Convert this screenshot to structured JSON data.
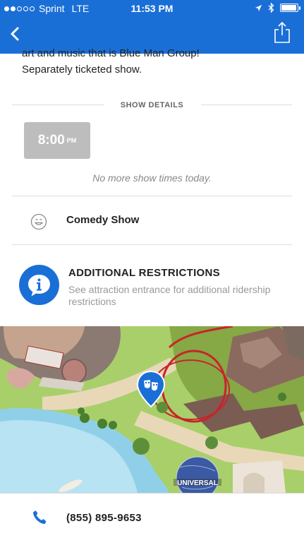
{
  "status_bar": {
    "carrier": "Sprint",
    "network": "LTE",
    "time": "11:53 PM",
    "signal_bars_filled": 2,
    "signal_bars_total": 5
  },
  "header": {
    "color": "#1a6fd6",
    "back_icon": "chevron-left-icon",
    "share_icon": "share-icon"
  },
  "description": {
    "line1": "art and music that is Blue Man Group!",
    "line2": "Separately ticketed show."
  },
  "show_details": {
    "label": "SHOW DETAILS",
    "show_time": "8:00",
    "show_time_ampm": "PM",
    "no_more_text": "No more show times today."
  },
  "show_type": {
    "icon": "smiley-icon",
    "label": "Comedy Show"
  },
  "restrictions": {
    "icon": "info-icon",
    "title": "ADDITIONAL RESTRICTIONS",
    "text": "See attraction entrance for additional ridership restrictions"
  },
  "map": {
    "pin_icon": "theater-masks-pin-icon",
    "globe_text": "UNIVERSAL"
  },
  "phone": {
    "icon": "phone-icon",
    "number": "(855) 895-9653"
  }
}
